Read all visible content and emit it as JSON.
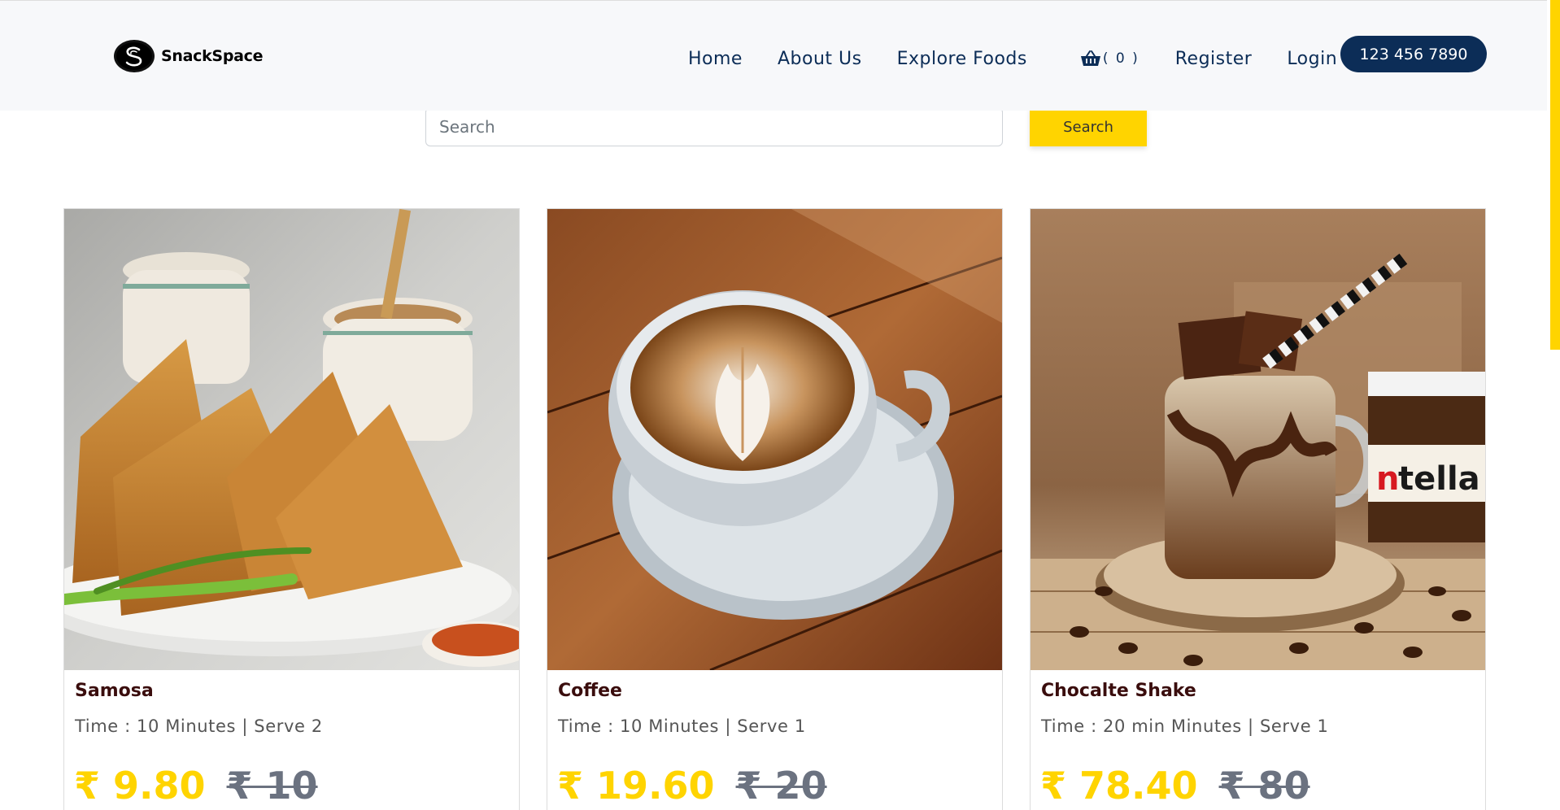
{
  "brand": {
    "name": "SnackSpace"
  },
  "nav": {
    "home": "Home",
    "about": "About Us",
    "explore": "Explore Foods",
    "cart_count": "( 0 )",
    "register": "Register",
    "login": "Login",
    "phone": "123 456 7890"
  },
  "search": {
    "placeholder": "Search",
    "button": "Search"
  },
  "products": [
    {
      "name": "Samosa",
      "meta": "Time : 10 Minutes | Serve 2",
      "price": "₹ 9.80",
      "old_price": "₹ 10"
    },
    {
      "name": "Coffee",
      "meta": "Time : 10 Minutes | Serve 1",
      "price": "₹ 19.60",
      "old_price": "₹ 20"
    },
    {
      "name": "Chocalte Shake",
      "meta": "Time : 20 min Minutes | Serve 1",
      "price": "₹ 78.40",
      "old_price": "₹ 80"
    }
  ],
  "colors": {
    "navy": "#0c2d57",
    "accent": "#ffd400",
    "nav_bg": "#f7f8fa",
    "title": "#3a0d0d",
    "old_price": "#6b7280"
  },
  "icons": [
    "logo-icon",
    "cart-icon"
  ]
}
